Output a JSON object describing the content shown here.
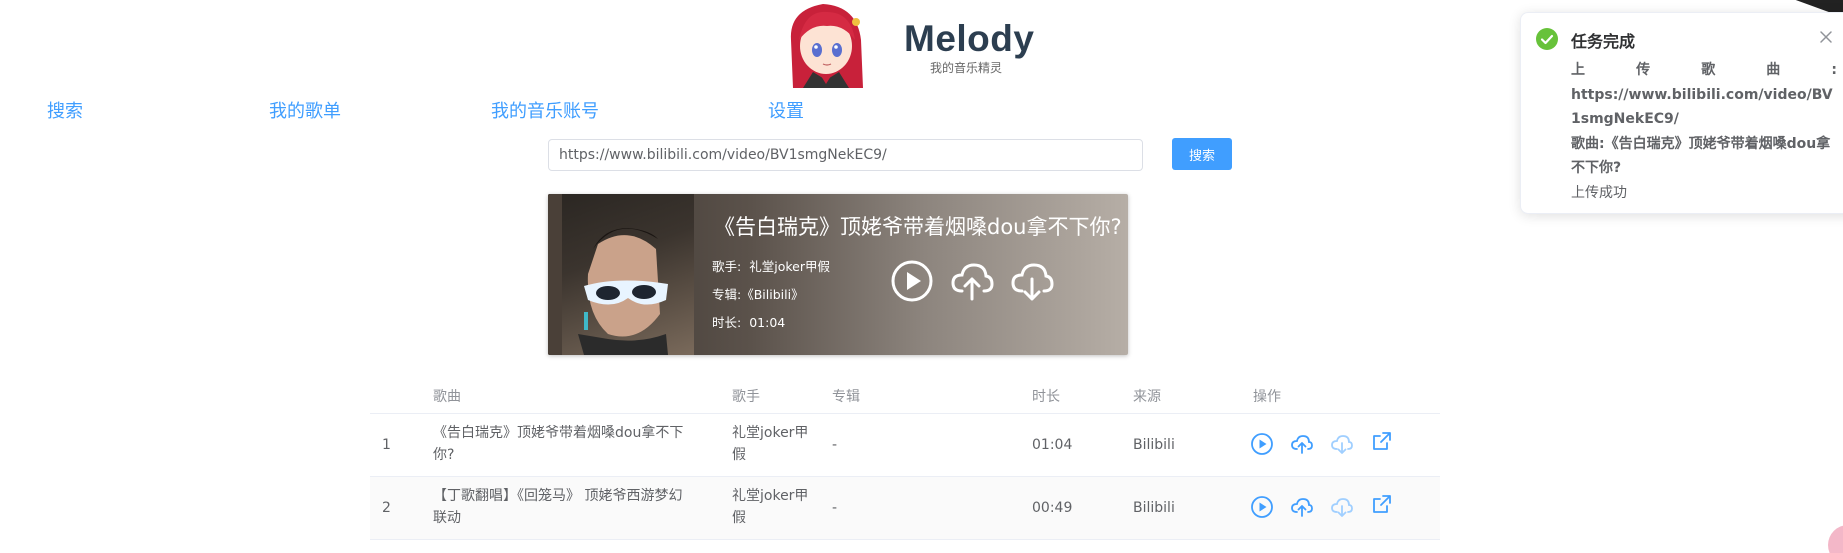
{
  "brand": {
    "title": "Melody",
    "subtitle": "我的音乐精灵"
  },
  "nav": [
    {
      "label": "搜索"
    },
    {
      "label": "我的歌单"
    },
    {
      "label": "我的音乐账号"
    },
    {
      "label": "设置"
    }
  ],
  "search": {
    "value": "https://www.bilibili.com/video/BV1smgNekEC9/",
    "button_label": "搜索"
  },
  "song_card": {
    "title": "《告白瑞克》顶姥爷带着烟嗓dou拿不下你?",
    "singer_key": "歌手:",
    "singer": "礼堂joker甲假",
    "album_key": "专辑:",
    "album": "《Bilibili》",
    "duration_key": "时长:",
    "duration": "01:04"
  },
  "table": {
    "headers": {
      "song": "歌曲",
      "singer": "歌手",
      "album": "专辑",
      "duration": "时长",
      "source": "来源",
      "actions": "操作"
    },
    "rows": [
      {
        "index": "1",
        "song": "《告白瑞克》顶姥爷带着烟嗓dou拿不下你?",
        "singer": "礼堂joker甲假",
        "album": "-",
        "duration": "01:04",
        "source": "Bilibili"
      },
      {
        "index": "2",
        "song": "【丁歌翻唱】《回笼马》 顶姥爷西游梦幻联动",
        "singer": "礼堂joker甲假",
        "album": "-",
        "duration": "00:49",
        "source": "Bilibili"
      }
    ]
  },
  "toast": {
    "title": "任务完成",
    "line_label": "上传歌曲:",
    "url": "https://www.bilibili.com/video/BV1smgNekEC9/",
    "song_line": "歌曲:《告白瑞克》顶姥爷带着烟嗓dou拿不下你?",
    "result": "上传成功"
  },
  "colors": {
    "accent": "#409eff",
    "success": "#67c23a",
    "download_faded": "#a0cfff"
  },
  "icons": {
    "play": "play-circle-icon",
    "upload": "cloud-upload-icon",
    "download": "cloud-download-icon",
    "external": "external-link-icon",
    "close": "close-icon",
    "success": "check-circle-icon"
  }
}
